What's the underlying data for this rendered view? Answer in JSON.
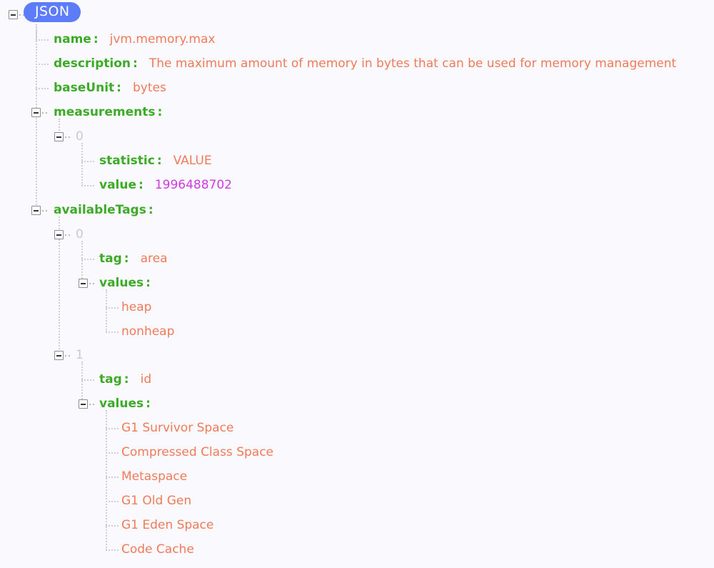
{
  "viewer": {
    "type": "json-tree-viewer",
    "root_label": "JSON",
    "background_color": "#faf9fd",
    "root_badge_color": "#5c7cfa",
    "key_color": "#3dab27",
    "string_value_color": "#f07a5a",
    "number_value_color": "#cf3ae0",
    "index_color": "#c9c9cf"
  },
  "tree": {
    "name": {
      "key": "name",
      "colon": ":",
      "value": "jvm.memory.max"
    },
    "description": {
      "key": "description",
      "colon": ":",
      "value": "The maximum amount of memory in bytes that can be used for memory management"
    },
    "baseUnit": {
      "key": "baseUnit",
      "colon": ":",
      "value": "bytes"
    },
    "measurements": {
      "key": "measurements",
      "colon": ":",
      "items": [
        {
          "index": "0",
          "statistic": {
            "key": "statistic",
            "colon": ":",
            "value": "VALUE"
          },
          "value": {
            "key": "value",
            "colon": ":",
            "value": "1996488702"
          }
        }
      ]
    },
    "availableTags": {
      "key": "availableTags",
      "colon": ":",
      "items": [
        {
          "index": "0",
          "tag": {
            "key": "tag",
            "colon": ":",
            "value": "area"
          },
          "values": {
            "key": "values",
            "colon": ":",
            "list": [
              "heap",
              "nonheap"
            ]
          }
        },
        {
          "index": "1",
          "tag": {
            "key": "tag",
            "colon": ":",
            "value": "id"
          },
          "values": {
            "key": "values",
            "colon": ":",
            "list": [
              "G1 Survivor Space",
              "Compressed Class Space",
              "Metaspace",
              "G1 Old Gen",
              "G1 Eden Space",
              "Code Cache"
            ]
          }
        }
      ]
    }
  }
}
